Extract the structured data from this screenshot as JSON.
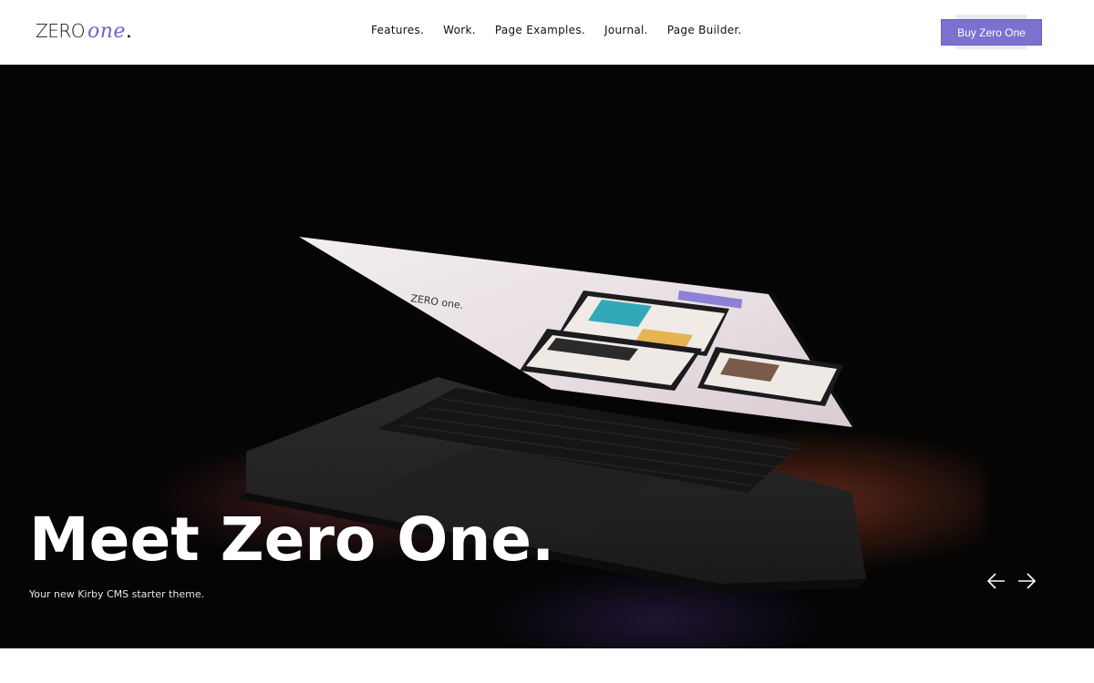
{
  "header": {
    "logo": {
      "zero": "ZERO",
      "one": "one",
      "dot": ".",
      "accent_color": "#6f63c9"
    },
    "nav": [
      {
        "label": "Features."
      },
      {
        "label": "Work."
      },
      {
        "label": "Page Examples."
      },
      {
        "label": "Journal."
      },
      {
        "label": "Page Builder."
      }
    ],
    "buy_button": {
      "label": "Buy Zero One",
      "color": "#7b71cf"
    }
  },
  "hero": {
    "title": "Meet Zero One.",
    "subtitle": "Your new Kirby CMS starter theme.",
    "prev_icon": "arrow-left-icon",
    "next_icon": "arrow-right-icon",
    "image": "laptop-photo",
    "background_color": "#050505"
  }
}
